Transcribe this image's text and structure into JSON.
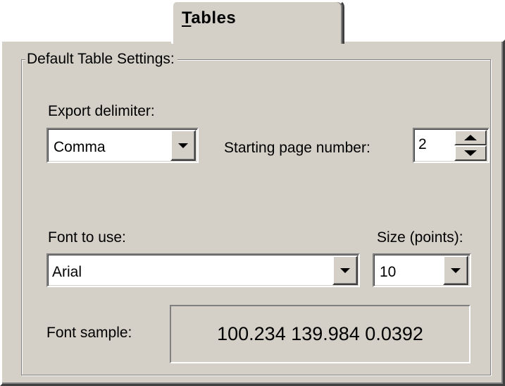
{
  "tab": {
    "mnemonic": "T",
    "label_rest": "ables"
  },
  "group": {
    "title": "Default Table Settings:"
  },
  "export_delimiter": {
    "label": "Export delimiter:",
    "value": "Comma"
  },
  "starting_page": {
    "label": "Starting page number:",
    "value": "2"
  },
  "font": {
    "label": "Font to use:",
    "value": "Arial"
  },
  "size": {
    "label": "Size (points):",
    "value": "10"
  },
  "sample": {
    "label": "Font sample:",
    "text": "100.234 139.984 0.0392"
  },
  "icons": {
    "dropdown": "chevron-down-icon",
    "spinner_up": "arrow-up-icon",
    "spinner_down": "arrow-down-icon"
  },
  "colors": {
    "face": "#d4d0c8",
    "field": "#ffffff",
    "shadow": "#808080"
  }
}
